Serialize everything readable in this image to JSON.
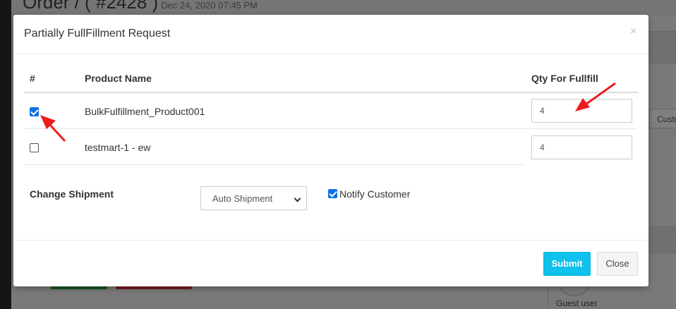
{
  "background": {
    "order_title": "Order / ( #2428 )",
    "order_date": "Dec 24, 2020 07:45 PM",
    "cust_label": "Custo",
    "guest_user": "Guest user"
  },
  "modal": {
    "title": "Partially FullFillment Request",
    "close_symbol": "×",
    "table": {
      "headers": {
        "hash": "#",
        "product_name": "Product Name",
        "qty": "Qty For Fullfill"
      },
      "rows": [
        {
          "checked": true,
          "product_name": "BulkFulfillment_Product001",
          "qty": "4"
        },
        {
          "checked": false,
          "product_name": "testmart-1 - ew",
          "qty": "4"
        }
      ]
    },
    "shipment": {
      "label": "Change Shipment",
      "selected": "Auto Shipment",
      "notify_label": "Notify Customer",
      "notify_checked": true
    },
    "footer": {
      "submit_label": "Submit",
      "close_label": "Close"
    }
  },
  "colors": {
    "submit_bg": "#0fc1ec",
    "checkbox_accent": "#0b72e7",
    "annotation_arrow": "#ee1c1c"
  }
}
